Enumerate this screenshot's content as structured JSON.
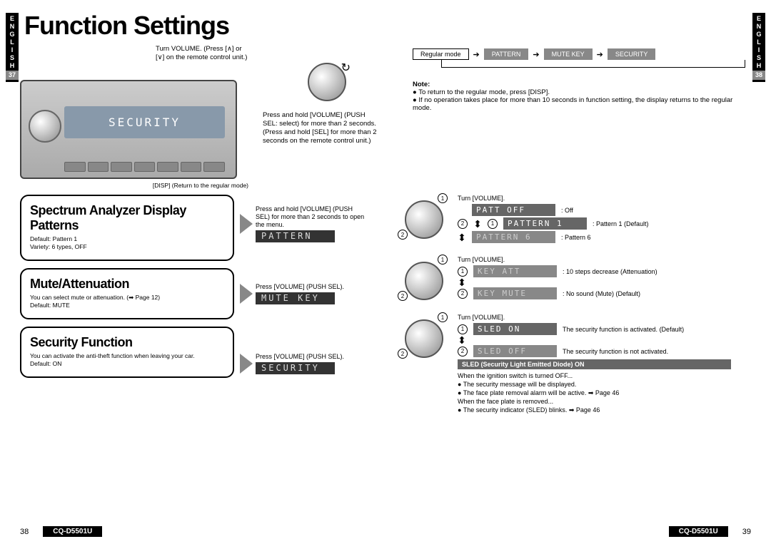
{
  "title": "Function Settings",
  "sideTab": {
    "lang": "ENGLISH",
    "leftPage": "37",
    "rightPage": "38"
  },
  "topInstr1": "Turn VOLUME. (Press [∧] or [∨] on the remote control unit.)",
  "topInstr2": "Press and hold [VOLUME] (PUSH SEL: select) for more than 2 seconds. (Press and hold [SEL] for more than 2 seconds on the remote control unit.)",
  "dispNote": "[DISP] (Return to the regular mode)",
  "radioDisplay": "SECURITY",
  "modeChain": [
    "Regular mode",
    "PATTERN",
    "MUTE KEY",
    "SECURITY"
  ],
  "noteTitle": "Note:",
  "noteLines": [
    "To return to the regular mode, press [DISP].",
    "If no operation takes place for more than 10 seconds in function setting, the display returns to the regular mode."
  ],
  "features": [
    {
      "title": "Spectrum Analyzer Display Patterns",
      "lines": [
        "Default: Pattern 1",
        "Variety: 6 types, OFF"
      ]
    },
    {
      "title": "Mute/Attenuation",
      "lines": [
        "You can select mute or attenuation. (➡ Page 12)",
        "Default: MUTE"
      ]
    },
    {
      "title": "Security Function",
      "lines": [
        "You can activate the anti-theft function when leaving your car.",
        "Default: ON"
      ]
    }
  ],
  "mid": [
    {
      "text": "Press and hold [VOLUME] (PUSH SEL) for more than 2 seconds to open the menu.",
      "lcd": "PATTERN"
    },
    {
      "text": "Press [VOLUME] (PUSH SEL).",
      "lcd": "MUTE KEY"
    },
    {
      "text": "Press [VOLUME] (PUSH SEL).",
      "lcd": "SECURITY"
    }
  ],
  "right": {
    "turnVol": "Turn [VOLUME].",
    "pattern": [
      {
        "lcd": "PATT OFF",
        "desc": ": Off"
      },
      {
        "lcd": "PATTERN 1",
        "desc": ": Pattern 1 (Default)"
      },
      {
        "lcd": "PATTERN 6",
        "desc": ": Pattern 6"
      }
    ],
    "mute": [
      {
        "num": "①",
        "lcd": "KEY ATT",
        "desc": ": 10 steps decrease (Attenuation)"
      },
      {
        "num": "②",
        "lcd": "KEY MUTE",
        "desc": ": No sound (Mute) (Default)"
      }
    ],
    "security": [
      {
        "num": "①",
        "lcd": "SLED ON",
        "desc": "The security function is activated. (Default)"
      },
      {
        "num": "②",
        "lcd": "SLED OFF",
        "desc": "The security function is not activated."
      }
    ],
    "sledBar": "SLED (Security Light Emitted Diode) ON",
    "secNotes1": "When the ignition switch is turned OFF...",
    "secBullets1": [
      "The security message will be displayed.",
      "The face plate removal alarm will be active. ➡ Page 46"
    ],
    "secNotes2": "When the face plate is removed...",
    "secBullets2": [
      "The security indicator (SLED) blinks. ➡ Page 46"
    ]
  },
  "footer": {
    "leftNum": "38",
    "rightNum": "39",
    "model": "CQ-D5501U"
  }
}
